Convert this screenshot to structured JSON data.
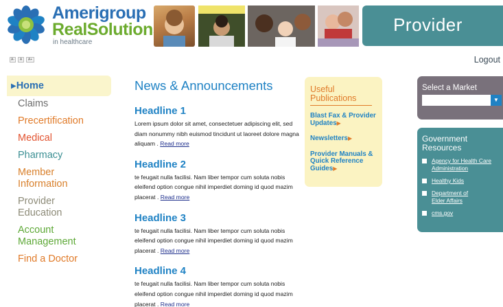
{
  "header": {
    "brand_line1": "Amerigroup",
    "brand_line2": "RealSolutions",
    "brand_line2_suffix": "®",
    "brand_line3": "in healthcare",
    "banner": "Provider",
    "font_size_controls": [
      "A-",
      "A",
      "A+"
    ],
    "logout": "Logout"
  },
  "nav": {
    "items": [
      {
        "label": "Home",
        "color": "#2a6fb4"
      },
      {
        "label": "Claims",
        "color": "#6c6c6c"
      },
      {
        "label": "Precertification",
        "color": "#e07a28"
      },
      {
        "label": "Medical",
        "color": "#e25330"
      },
      {
        "label": "Pharmacy",
        "color": "#3b8f93"
      },
      {
        "label": "Member Information",
        "color": "#d87f2a"
      },
      {
        "label": "Provider Education",
        "color": "#8c8a77"
      },
      {
        "label": "Account Management",
        "color": "#5da836"
      },
      {
        "label": "Find a Doctor",
        "color": "#e07a28"
      }
    ]
  },
  "news": {
    "title": "News & Announcements",
    "read_more": "Read more",
    "items": [
      {
        "headline": "Headline 1",
        "body": "Lorem ipsum dolor sit amet, consectetuer adipiscing elit, sed diam nonummy nibh euismod tincidunt ut laoreet dolore magna aliquam . "
      },
      {
        "headline": "Headline 2",
        "body": "te feugait nulla facilisi. Nam liber tempor cum soluta nobis eleifend option congue nihil imperdiet doming id quod mazim placerat . "
      },
      {
        "headline": "Headline 3",
        "body": "te feugait nulla facilisi. Nam liber tempor cum soluta nobis eleifend option congue nihil imperdiet doming id quod mazim placerat . "
      },
      {
        "headline": "Headline 4",
        "body": "te feugait nulla facilisi. Nam liber tempor cum soluta nobis eleifend option congue nihil imperdiet doming id quod mazim placerat . "
      }
    ]
  },
  "publications": {
    "title": "Useful Publications",
    "links": [
      "Blast Fax & Provider Updates",
      "Newsletters",
      "Provider Manuals & Quick Reference Guides"
    ]
  },
  "market": {
    "title": "Select a Market",
    "selected": ""
  },
  "government": {
    "title": "Government Resources",
    "links": [
      "Agency for Health Care Administration",
      "Healthy Kids",
      "Department of Elder Affairs",
      "cms.gov"
    ]
  },
  "colors": {
    "brand_blue": "#2a6fb4",
    "brand_green": "#6cab2e",
    "teal_panel": "#4a8f95",
    "market_panel": "#79717b",
    "publications_bg": "#fbf3c2"
  },
  "icons": [
    "amerigroup-starburst-logo-icon",
    "nav-arrow-icon",
    "chevron-right-icon",
    "dropdown-arrow-icon",
    "bullet-square-icon"
  ]
}
